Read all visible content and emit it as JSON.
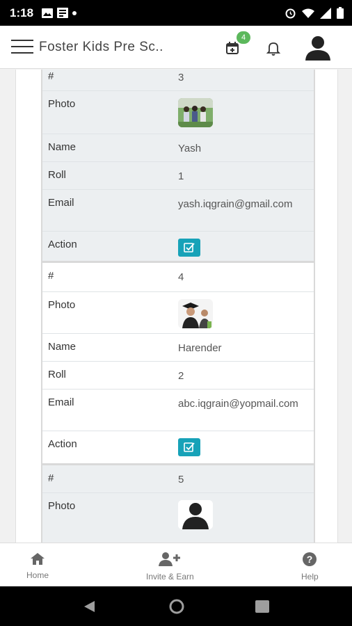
{
  "status_bar": {
    "time": "1:18"
  },
  "app_bar": {
    "title": "Foster Kids Pre Sc..",
    "notification_count": "4"
  },
  "records": [
    {
      "index": "3",
      "labels": {
        "index": "#",
        "photo": "Photo",
        "name": "Name",
        "roll": "Roll",
        "email": "Email",
        "action": "Action"
      },
      "name": "Yash",
      "roll": "1",
      "email": "yash.iqgrain@gmail.com",
      "photo": "group-photo"
    },
    {
      "index": "4",
      "labels": {
        "index": "#",
        "photo": "Photo",
        "name": "Name",
        "roll": "Roll",
        "email": "Email",
        "action": "Action"
      },
      "name": "Harender",
      "roll": "2",
      "email": "abc.iqgrain@yopmail.com",
      "photo": "graduate-photo"
    },
    {
      "index": "5",
      "labels": {
        "index": "#",
        "photo": "Photo"
      },
      "photo": "default-avatar"
    }
  ],
  "bottom_nav": {
    "home": "Home",
    "invite": "Invite & Earn",
    "help": "Help"
  },
  "colors": {
    "action": "#17a2b8",
    "badge": "#5cb85c",
    "record_alt_bg": "#eceff1"
  }
}
